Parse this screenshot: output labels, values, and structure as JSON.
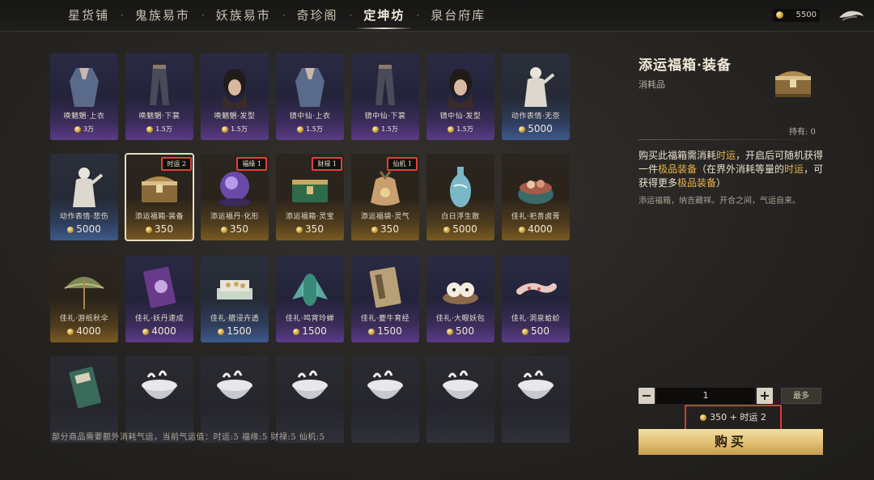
{
  "nav": {
    "tabs": [
      "星货铺",
      "鬼族易市",
      "妖族易市",
      "奇珍阁",
      "定坤坊",
      "泉台府库"
    ],
    "active_index": 4,
    "separator": "·",
    "currency": "5500"
  },
  "items": [
    {
      "name": "唤魑魍·上衣",
      "price": "3万",
      "tier": "purple",
      "icon": "robe-upper-icon"
    },
    {
      "name": "唤魑魍·下裳",
      "price": "1.5万",
      "tier": "purple",
      "icon": "robe-lower-icon"
    },
    {
      "name": "唤魑魍·发型",
      "price": "1.5万",
      "tier": "purple",
      "icon": "hairstyle-icon"
    },
    {
      "name": "镜中仙·上衣",
      "price": "1.5万",
      "tier": "purple",
      "icon": "robe-upper-icon"
    },
    {
      "name": "镜中仙·下裳",
      "price": "1.5万",
      "tier": "purple",
      "icon": "robe-lower-icon"
    },
    {
      "name": "镜中仙·发型",
      "price": "1.5万",
      "tier": "purple",
      "icon": "hairstyle-icon"
    },
    {
      "name": "动作表情·无奈",
      "price": "5000",
      "tier": "blue",
      "icon": "emote-figure-icon"
    },
    {
      "name": "动作表情·悲伤",
      "price": "5000",
      "tier": "blue",
      "icon": "emote-figure-icon"
    },
    {
      "name": "添运福箱·装备",
      "price": "350",
      "tier": "gold",
      "icon": "treasure-chest-icon",
      "badge": "时运 2",
      "selected": true
    },
    {
      "name": "添运福丹·化形",
      "price": "350",
      "tier": "gold",
      "icon": "spirit-orb-icon",
      "badge": "福缘 1"
    },
    {
      "name": "添运福箱·灵宝",
      "price": "350",
      "tier": "gold",
      "icon": "jade-chest-icon",
      "badge": "财禄 1"
    },
    {
      "name": "添运福袋·灵气",
      "price": "350",
      "tier": "gold",
      "icon": "fortune-bag-icon",
      "badge": "仙机 1"
    },
    {
      "name": "白日浮生散",
      "price": "5000",
      "tier": "gold",
      "icon": "porcelain-vase-icon"
    },
    {
      "name": "佳礼·祀善卤膏",
      "price": "4000",
      "tier": "gold",
      "icon": "food-bowl-icon"
    },
    {
      "name": "佳礼·游纸秋伞",
      "price": "4000",
      "tier": "gold",
      "icon": "paper-umbrella-icon"
    },
    {
      "name": "佳礼·妖丹速成",
      "price": "4000",
      "tier": "purple",
      "icon": "purple-book-icon"
    },
    {
      "name": "佳礼·腊浸卉透",
      "price": "1500",
      "tier": "blue",
      "icon": "tray-icon"
    },
    {
      "name": "佳礼·鸣宵玲蝉",
      "price": "1500",
      "tier": "purple",
      "icon": "cicada-icon"
    },
    {
      "name": "佳礼·夔牛育经",
      "price": "1500",
      "tier": "purple",
      "icon": "old-book-icon"
    },
    {
      "name": "佳礼·大眼妖包",
      "price": "500",
      "tier": "purple",
      "icon": "buns-icon"
    },
    {
      "name": "佳礼·洞泉蛤蚧",
      "price": "500",
      "tier": "purple",
      "icon": "gecko-icon"
    },
    {
      "name": "",
      "price": "",
      "tier": "dark",
      "icon": "green-book-icon"
    },
    {
      "name": "",
      "price": "",
      "tier": "dark",
      "icon": "rice-bowl-icon"
    },
    {
      "name": "",
      "price": "",
      "tier": "dark",
      "icon": "rice-bowl-icon"
    },
    {
      "name": "",
      "price": "",
      "tier": "dark",
      "icon": "rice-bowl-icon"
    },
    {
      "name": "",
      "price": "",
      "tier": "dark",
      "icon": "rice-bowl-icon"
    },
    {
      "name": "",
      "price": "",
      "tier": "dark",
      "icon": "rice-bowl-icon"
    },
    {
      "name": "",
      "price": "",
      "tier": "dark",
      "icon": "rice-bowl-icon"
    }
  ],
  "footnote": "部分商品需要额外消耗气运，当前气运值：时运:5   福缘:5   财禄:5   仙机:5",
  "detail": {
    "title": "添运福箱·装备",
    "category": "消耗品",
    "owned": "持有: 0",
    "desc_parts": [
      {
        "text": "购买此福箱需消耗",
        "hl": false
      },
      {
        "text": "时运",
        "hl": true
      },
      {
        "text": "，开启后可随机获得一件",
        "hl": false
      },
      {
        "text": "极品装备",
        "hl": true
      },
      {
        "text": "（在界外消耗等量的",
        "hl": false
      },
      {
        "text": "时运",
        "hl": true
      },
      {
        "text": "，可获得更多",
        "hl": false
      },
      {
        "text": "极品装备",
        "hl": true
      },
      {
        "text": "）",
        "hl": false
      }
    ],
    "lore": "添运福箱，纳吉藏祥。开合之间，气运自来。",
    "quantity": "1",
    "minus": "−",
    "plus": "+",
    "max_label": "最多",
    "cost": "350  + 时运 2",
    "buy_label": "购买"
  }
}
